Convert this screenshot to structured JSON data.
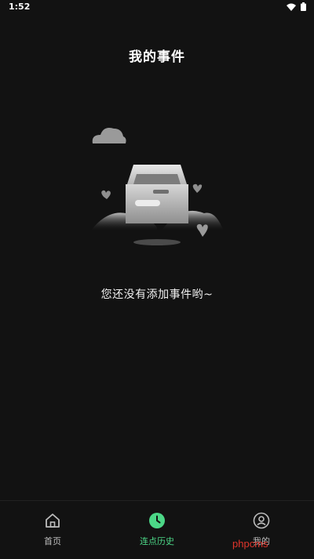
{
  "status_bar": {
    "time": "1:52",
    "icons": [
      "wifi-icon",
      "battery-icon"
    ]
  },
  "header": {
    "title": "我的事件"
  },
  "empty_state": {
    "illustration": "empty-box-illustration",
    "message": "您还没有添加事件哟~"
  },
  "bottom_nav": {
    "items": [
      {
        "label": "首页",
        "icon": "home-icon",
        "active": false
      },
      {
        "label": "连点历史",
        "icon": "clock-icon",
        "active": true
      },
      {
        "label": "我的",
        "icon": "profile-icon",
        "active": false
      }
    ]
  },
  "watermark": {
    "text": "phpcms"
  },
  "colors": {
    "background": "#121212",
    "accent": "#4cd787",
    "watermark": "#e0352b"
  }
}
